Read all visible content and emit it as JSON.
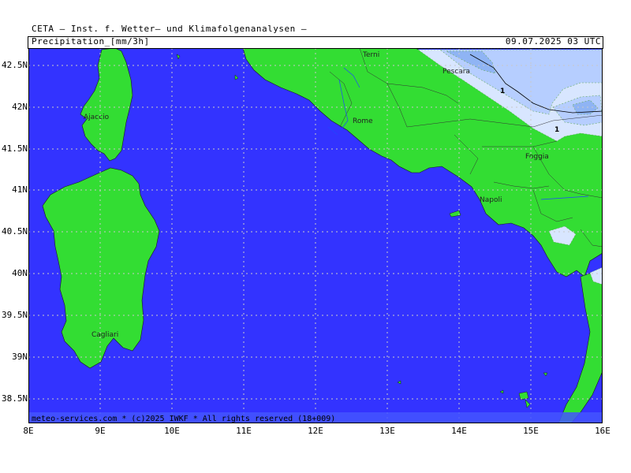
{
  "header": {
    "institute": "CETA — Inst. f. Wetter— und Klimafolgenanalysen —",
    "parameter": "Precipitation_[mm/3h]",
    "datetime": "09.07.2025 03 UTC"
  },
  "footer": {
    "credit": "meteo-services.com * (c)2025 IWKF * All rights reserved (18+009)"
  },
  "axes": {
    "lat_ticks": [
      "42.5N",
      "42N",
      "41.5N",
      "41N",
      "40.5N",
      "40N",
      "39.5N",
      "39N",
      "38.5N"
    ],
    "lon_ticks": [
      "8E",
      "9E",
      "10E",
      "11E",
      "12E",
      "13E",
      "14E",
      "15E",
      "16E"
    ]
  },
  "cities": [
    "Terni",
    "Pescara",
    "Rome",
    "Foggia",
    "Napoli",
    "Ajaccio",
    "Cagliari"
  ],
  "contour_labels": [
    "1",
    "1"
  ],
  "colors": {
    "sea": "#3333ff",
    "land": "#33dd33",
    "precip_light": "#d8e6ff",
    "precip_mid": "#b6ceff",
    "precip_heavy": "#8fb4f4",
    "grid": "#bbbbbb"
  }
}
